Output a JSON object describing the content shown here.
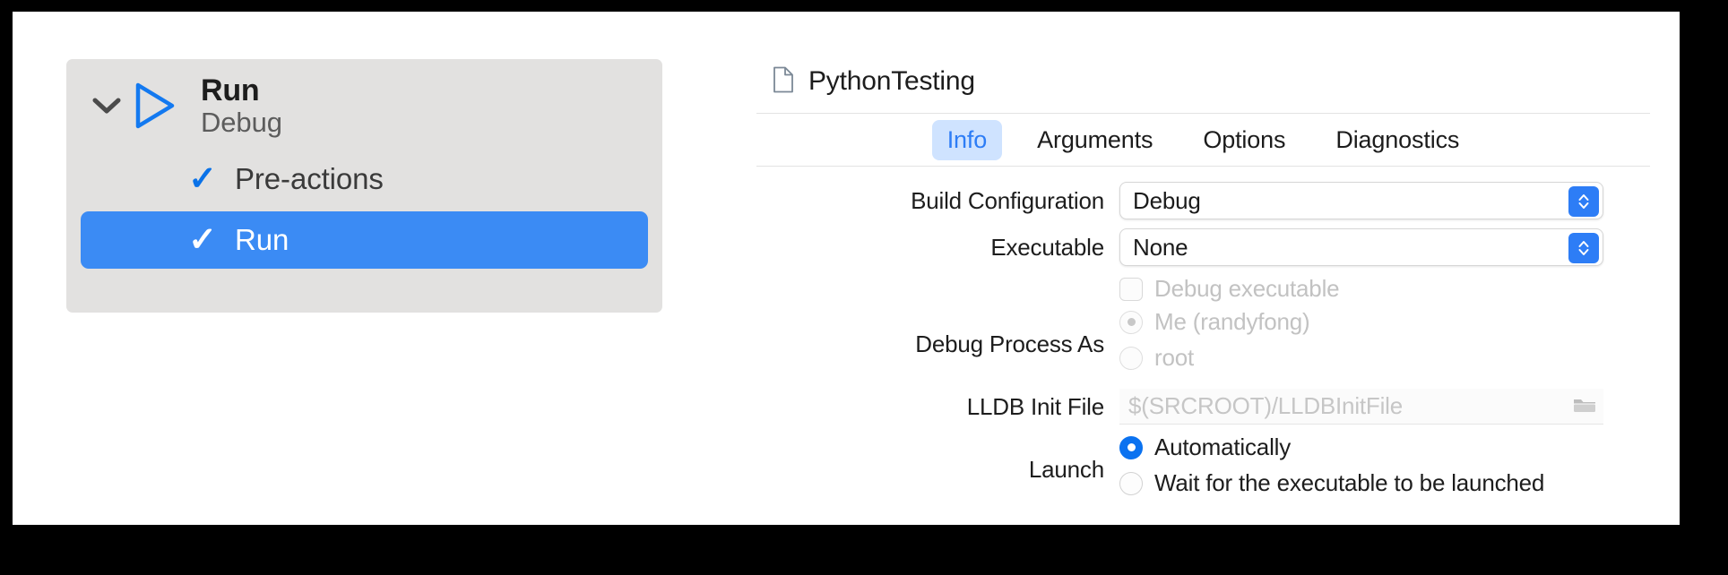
{
  "window": {
    "background_color": "#000000",
    "sheet_color": "#ffffff"
  },
  "scheme_panel": {
    "panel_color": "#e2e1e0",
    "selection_color": "#3b8bf4",
    "accent_color": "#0a72e8",
    "group": {
      "disclosure_icon": "chevron-down-icon",
      "action_icon": "play-triangle-icon",
      "title": "Run",
      "subtitle": "Debug"
    },
    "items": [
      {
        "label": "Pre-actions",
        "checked": true,
        "check_glyph": "✓",
        "selected": false
      },
      {
        "label": "Run",
        "checked": true,
        "check_glyph": "✓",
        "selected": true
      }
    ]
  },
  "detail": {
    "title": "PythonTesting",
    "title_icon": "document-icon",
    "tabs": [
      {
        "label": "Info",
        "selected": true
      },
      {
        "label": "Arguments",
        "selected": false
      },
      {
        "label": "Options",
        "selected": false
      },
      {
        "label": "Diagnostics",
        "selected": false
      }
    ],
    "tab_selected_bg": "#cfe3ff",
    "tab_selected_fg": "#2d7df6",
    "form": {
      "build_configuration": {
        "label": "Build Configuration",
        "value": "Debug",
        "stepper_icon": "updown-chevrons-icon",
        "stepper_color": "#2d7df6"
      },
      "executable": {
        "label": "Executable",
        "value": "None",
        "stepper_icon": "updown-chevrons-icon",
        "stepper_color": "#2d7df6"
      },
      "debug_executable": {
        "label": "Debug executable",
        "checked": false,
        "enabled": false
      },
      "debug_process_as": {
        "label": "Debug Process As",
        "options": [
          {
            "label": "Me (randyfong)",
            "selected": true,
            "enabled": false
          },
          {
            "label": "root",
            "selected": false,
            "enabled": false
          }
        ]
      },
      "lldb_init_file": {
        "label": "LLDB Init File",
        "value": "",
        "placeholder": "$(SRCROOT)/LLDBInitFile",
        "browse_icon": "folder-icon"
      },
      "launch": {
        "label": "Launch",
        "options": [
          {
            "label": "Automatically",
            "selected": true,
            "enabled": true
          },
          {
            "label": "Wait for the executable to be launched",
            "selected": false,
            "enabled": true
          }
        ]
      }
    }
  }
}
